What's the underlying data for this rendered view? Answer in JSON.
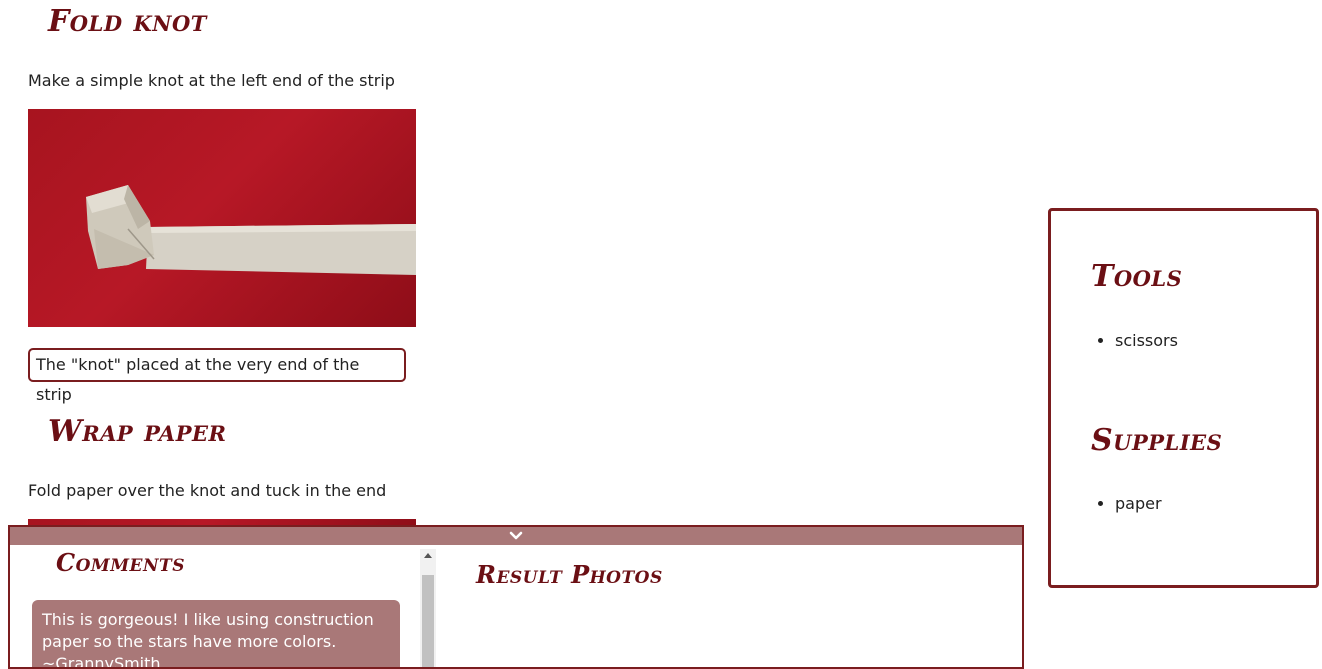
{
  "steps": [
    {
      "title": "Fold knot",
      "instruction": "Make a simple knot at the left end of the strip",
      "photo_alt": "Paper strip with a knot folded at its left end on red background",
      "caption": "The \"knot\" placed at the very end of the strip"
    },
    {
      "title": "Wrap paper",
      "instruction": "Fold paper over the knot and tuck in the end"
    }
  ],
  "sidebar": {
    "tools_title": "Tools",
    "tools": [
      "scissors"
    ],
    "supplies_title": "Supplies",
    "supplies": [
      "paper"
    ]
  },
  "bottom_panel": {
    "toggle_icon": "chevron-down-icon",
    "comments_title": "Comments",
    "comments": [
      {
        "text": "This is gorgeous! I like using construction paper so the stars have more colors. ~GrannySmith"
      }
    ],
    "results_title": "Result Photos"
  },
  "colors": {
    "accent": "#6b0f14",
    "border": "#7a1d1f",
    "panel_bar": "#a97878",
    "photo_red": "#b71826"
  }
}
